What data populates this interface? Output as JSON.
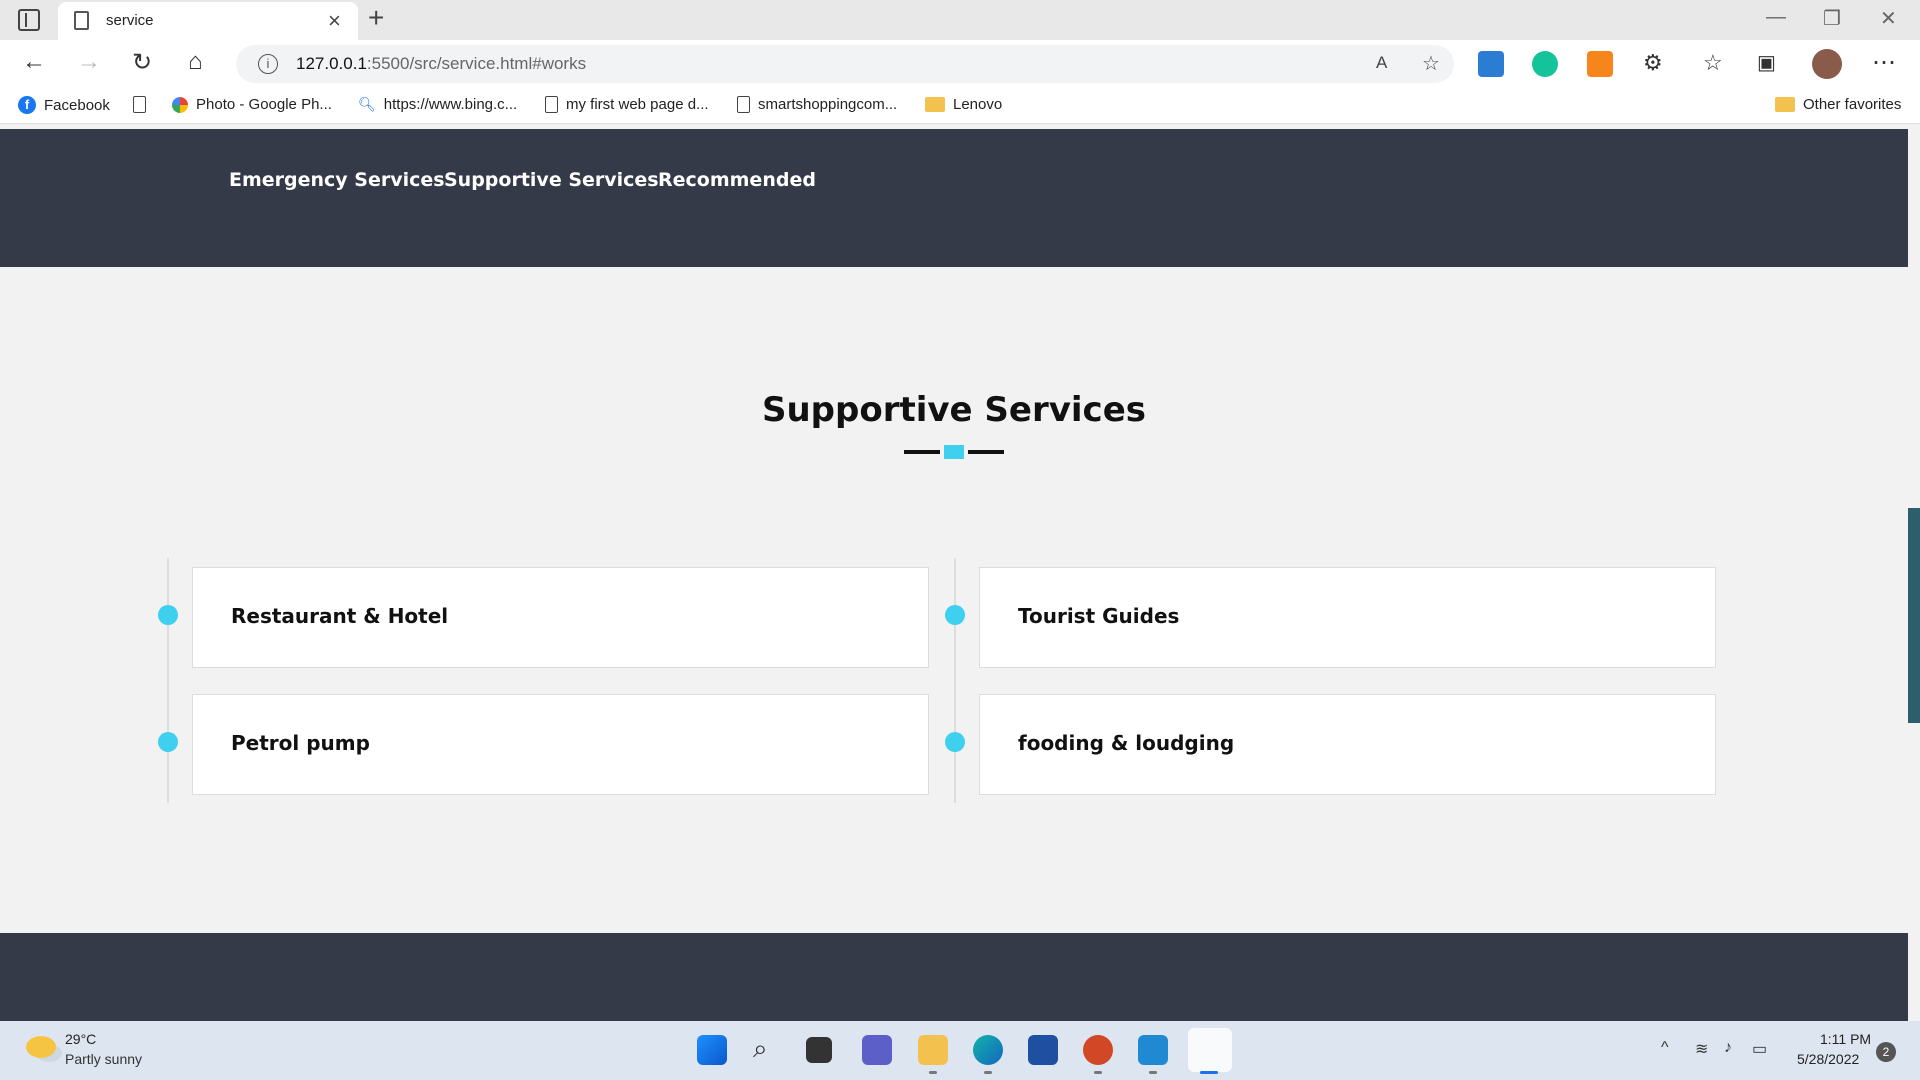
{
  "browser": {
    "tab_title": "service",
    "url_host": "127.0.0.1",
    "url_rest": ":5500/src/service.html#works",
    "bookmarks": [
      {
        "label": "Facebook"
      },
      {
        "label": ""
      },
      {
        "label": "Photo - Google Ph..."
      },
      {
        "label": "https://www.bing.c..."
      },
      {
        "label": "my first web page d..."
      },
      {
        "label": "smartshoppingcom..."
      },
      {
        "label": "Lenovo"
      }
    ],
    "other_favorites": "Other favorites"
  },
  "site": {
    "nav": [
      "Emergency Services",
      "Supportive Services",
      "Recommended"
    ],
    "section_title": "Supportive Services",
    "services": [
      {
        "label": "Restaurant & Hotel"
      },
      {
        "label": "Tourist Guides"
      },
      {
        "label": "Petrol pump"
      },
      {
        "label": "fooding & loudging"
      }
    ]
  },
  "taskbar": {
    "temperature": "29°C",
    "weather": "Partly sunny",
    "time": "1:11 PM",
    "date": "5/28/2022",
    "notifications": "2"
  },
  "colors": {
    "accent": "#3fd0f0",
    "nav_bg": "#353a48"
  }
}
